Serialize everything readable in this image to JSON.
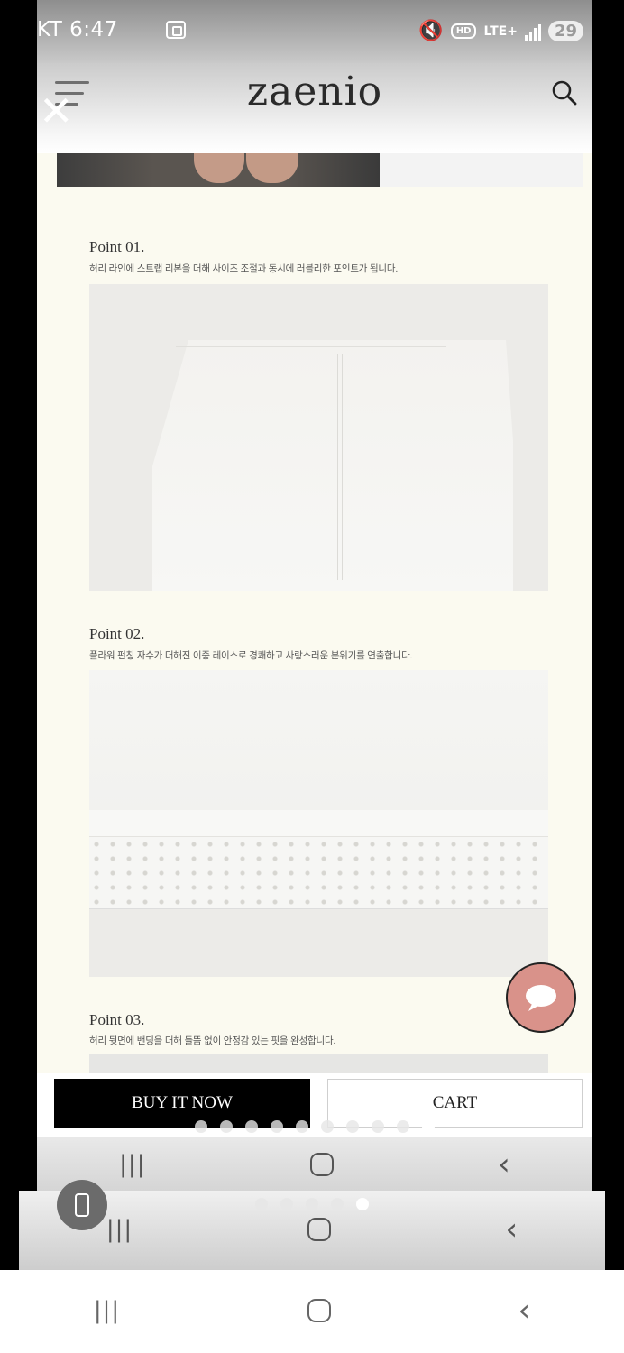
{
  "status_bar": {
    "carrier_time": "KT 6:47",
    "network": "LTE+",
    "hd_label": "HD",
    "battery": "29"
  },
  "header": {
    "logo": "zaenio"
  },
  "points": [
    {
      "title": "Point 01.",
      "desc": "허리 라인에 스트랩 리본을 더해 사이즈 조절과 동시에 러블리한 포인트가 됩니다."
    },
    {
      "title": "Point 02.",
      "desc": "플라워 펀칭 자수가 더해진 이중 레이스로 경쾌하고 사랑스러운 분위기를 연출합니다."
    },
    {
      "title": "Point 03.",
      "desc": "허리 뒷면에 밴딩을 더해 들뜸 없이 안정감 있는 핏을 완성합니다."
    }
  ],
  "actions": {
    "buy_now": "BUY IT NOW",
    "cart": "CART"
  },
  "icons": {
    "menu": "menu-icon",
    "close": "close-icon",
    "search": "search-icon",
    "chat": "chat-bubble-icon",
    "phone": "phone-icon"
  },
  "colors": {
    "content_bg": "#fbfaf0",
    "buy_button": "#000000",
    "chat_button": "#d9928a"
  }
}
